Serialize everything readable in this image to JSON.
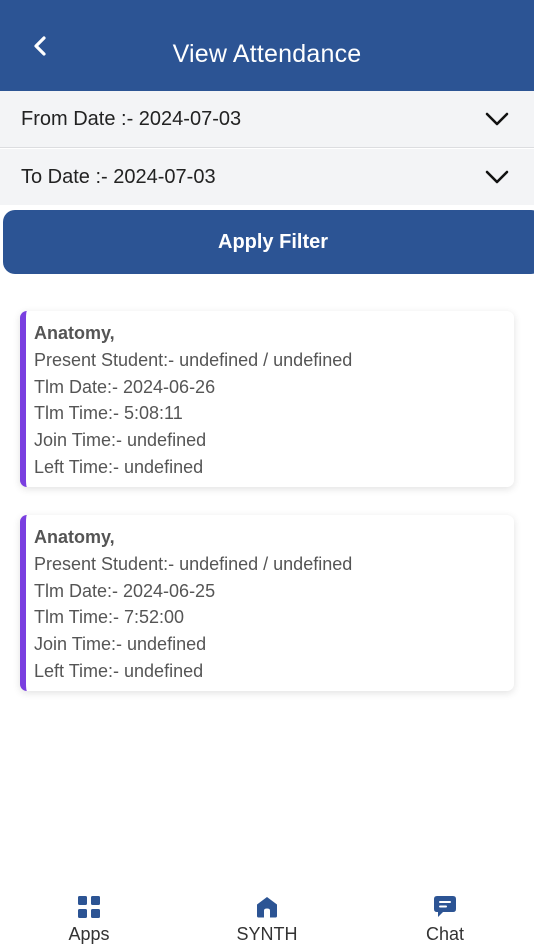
{
  "header": {
    "title": "View Attendance"
  },
  "filters": {
    "from_label": "From Date :- 2024-07-03",
    "to_label": "To Date :- 2024-07-03"
  },
  "apply_button": {
    "label": "Apply Filter"
  },
  "records": [
    {
      "subject": "Anatomy,",
      "present": "Present Student:- undefined / undefined",
      "tlm_date": "Tlm Date:- 2024-06-26",
      "tlm_time": "Tlm Time:- 5:08:11",
      "join_time": "Join Time:- undefined",
      "left_time": "Left Time:- undefined"
    },
    {
      "subject": "Anatomy,",
      "present": "Present Student:- undefined / undefined",
      "tlm_date": "Tlm Date:- 2024-06-25",
      "tlm_time": "Tlm Time:- 7:52:00",
      "join_time": "Join Time:- undefined",
      "left_time": "Left Time:- undefined"
    }
  ],
  "bottom_nav": [
    {
      "label": "Apps",
      "icon": "grid-icon"
    },
    {
      "label": "SYNTH",
      "icon": "home-icon"
    },
    {
      "label": "Chat",
      "icon": "chat-icon"
    }
  ],
  "colors": {
    "primary": "#2c5494",
    "card_accent": "#7a3fe0",
    "filter_bg": "#f3f4f6"
  }
}
